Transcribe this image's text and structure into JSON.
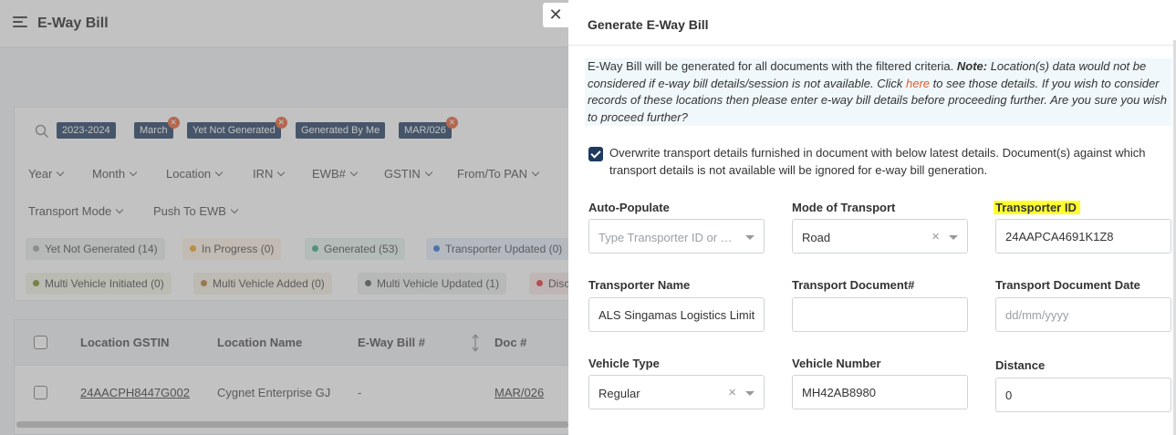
{
  "app": {
    "title": "E-Way Bill"
  },
  "filters": {
    "chips": [
      {
        "label": "2023-2024",
        "removable": false
      },
      {
        "label": "March",
        "removable": true
      },
      {
        "label": "Yet Not Generated",
        "removable": true
      },
      {
        "label": "Generated By Me",
        "removable": false
      },
      {
        "label": "MAR/026",
        "removable": true
      }
    ],
    "dropdowns": [
      "Year",
      "Month",
      "Location",
      "IRN",
      "EWB#",
      "GSTIN",
      "From/To PAN",
      "Transport Mode",
      "Push To EWB"
    ],
    "statuses": [
      {
        "label": "Yet Not Generated (14)",
        "dot": "#9e9e9e",
        "bg": "#eceeef"
      },
      {
        "label": "In Progress (0)",
        "dot": "#f0a020",
        "bg": "#fdf3e3"
      },
      {
        "label": "Generated (53)",
        "dot": "#2eaa7a",
        "bg": "#e5f5ee"
      },
      {
        "label": "Transporter Updated (0)",
        "dot": "#2f6fd6",
        "bg": "#e6eefb"
      },
      {
        "label": "Multi Vehicle Initiated (0)",
        "dot": "#7a8a1a",
        "bg": "#f1f2e3"
      },
      {
        "label": "Multi Vehicle Added (0)",
        "dot": "#b07a2a",
        "bg": "#f6efe4"
      },
      {
        "label": "Multi Vehicle Updated (1)",
        "dot": "#555555",
        "bg": "#eceeef"
      },
      {
        "label": "Disc",
        "dot": "#e03030",
        "bg": "#fbe8e8"
      }
    ]
  },
  "grid": {
    "columns": [
      "Location GSTIN",
      "Location Name",
      "E-Way Bill #",
      "Doc #"
    ],
    "rows": [
      {
        "gstin": "24AACPH8447G002",
        "name": "Cygnet Enterprise GJ",
        "ewb": "-",
        "doc": "MAR/026"
      }
    ]
  },
  "drawer": {
    "title": "Generate E-Way Bill",
    "note_intro": "E-Way Bill will be generated for all documents with the filtered criteria. ",
    "note_bold": "Note:",
    "note_1": " Location(s) data would not be considered if e-way bill details/session is not available. Click ",
    "note_link": "here",
    "note_2": " to see those details. If you wish to consider records of these locations then please enter e-way bill details before proceeding further. Are you sure you wish to proceed further?",
    "overwrite_text": "Overwrite transport details furnished in document with below latest details. Document(s) against which transport details is not available will be ignored for e-way bill generation.",
    "overwrite_checked": true,
    "labels": {
      "auto_populate": "Auto-Populate",
      "mode_of_transport": "Mode of Transport",
      "transporter_id": "Transporter ID",
      "transporter_name": "Transporter Name",
      "transport_doc": "Transport Document#",
      "transport_doc_date": "Transport Document Date",
      "vehicle_type": "Vehicle Type",
      "vehicle_number": "Vehicle Number",
      "distance": "Distance"
    },
    "values": {
      "auto_populate_placeholder": "Type Transporter ID or T...",
      "mode_of_transport": "Road",
      "transporter_id": "24AAPCA4691K1Z8",
      "transporter_name": "ALS Singamas Logistics Limit",
      "transport_doc": "",
      "transport_doc_date_placeholder": "dd/mm/yyyy",
      "vehicle_type": "Regular",
      "vehicle_number": "MH42AB8980",
      "distance": "0"
    },
    "close_label": "✕"
  }
}
